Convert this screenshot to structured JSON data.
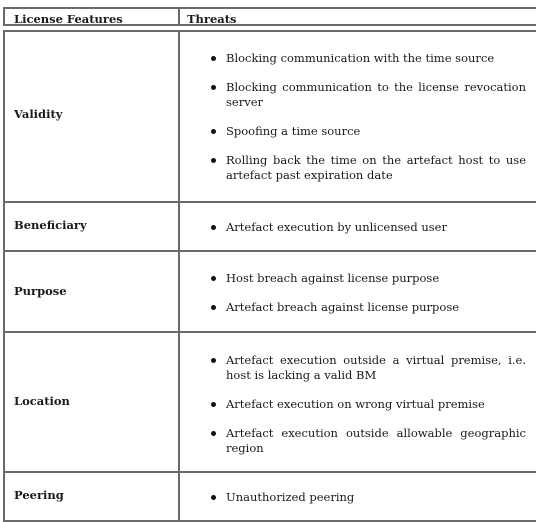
{
  "table": {
    "headers": [
      "License Features",
      "Threats"
    ],
    "rows": [
      {
        "feature": "Validity",
        "threats": [
          "Blocking communication with the time source",
          "Blocking communication to the license revocation server",
          "Spoofing a time source",
          "Rolling back the time on the artefact host to use artefact past expiration date"
        ]
      },
      {
        "feature": "Beneficiary",
        "threats": [
          "Artefact execution by unlicensed user"
        ]
      },
      {
        "feature": "Purpose",
        "threats": [
          "Host breach against license purpose",
          "Artefact breach against license purpose"
        ]
      },
      {
        "feature": "Location",
        "threats": [
          "Artefact execution outside a virtual premise, i.e. host is lacking a valid BM",
          "Artefact execution on wrong virtual premise",
          "Artefact execution outside allowable geographic region"
        ]
      },
      {
        "feature": "Peering",
        "threats": [
          "Unauthorized peering"
        ]
      }
    ]
  }
}
